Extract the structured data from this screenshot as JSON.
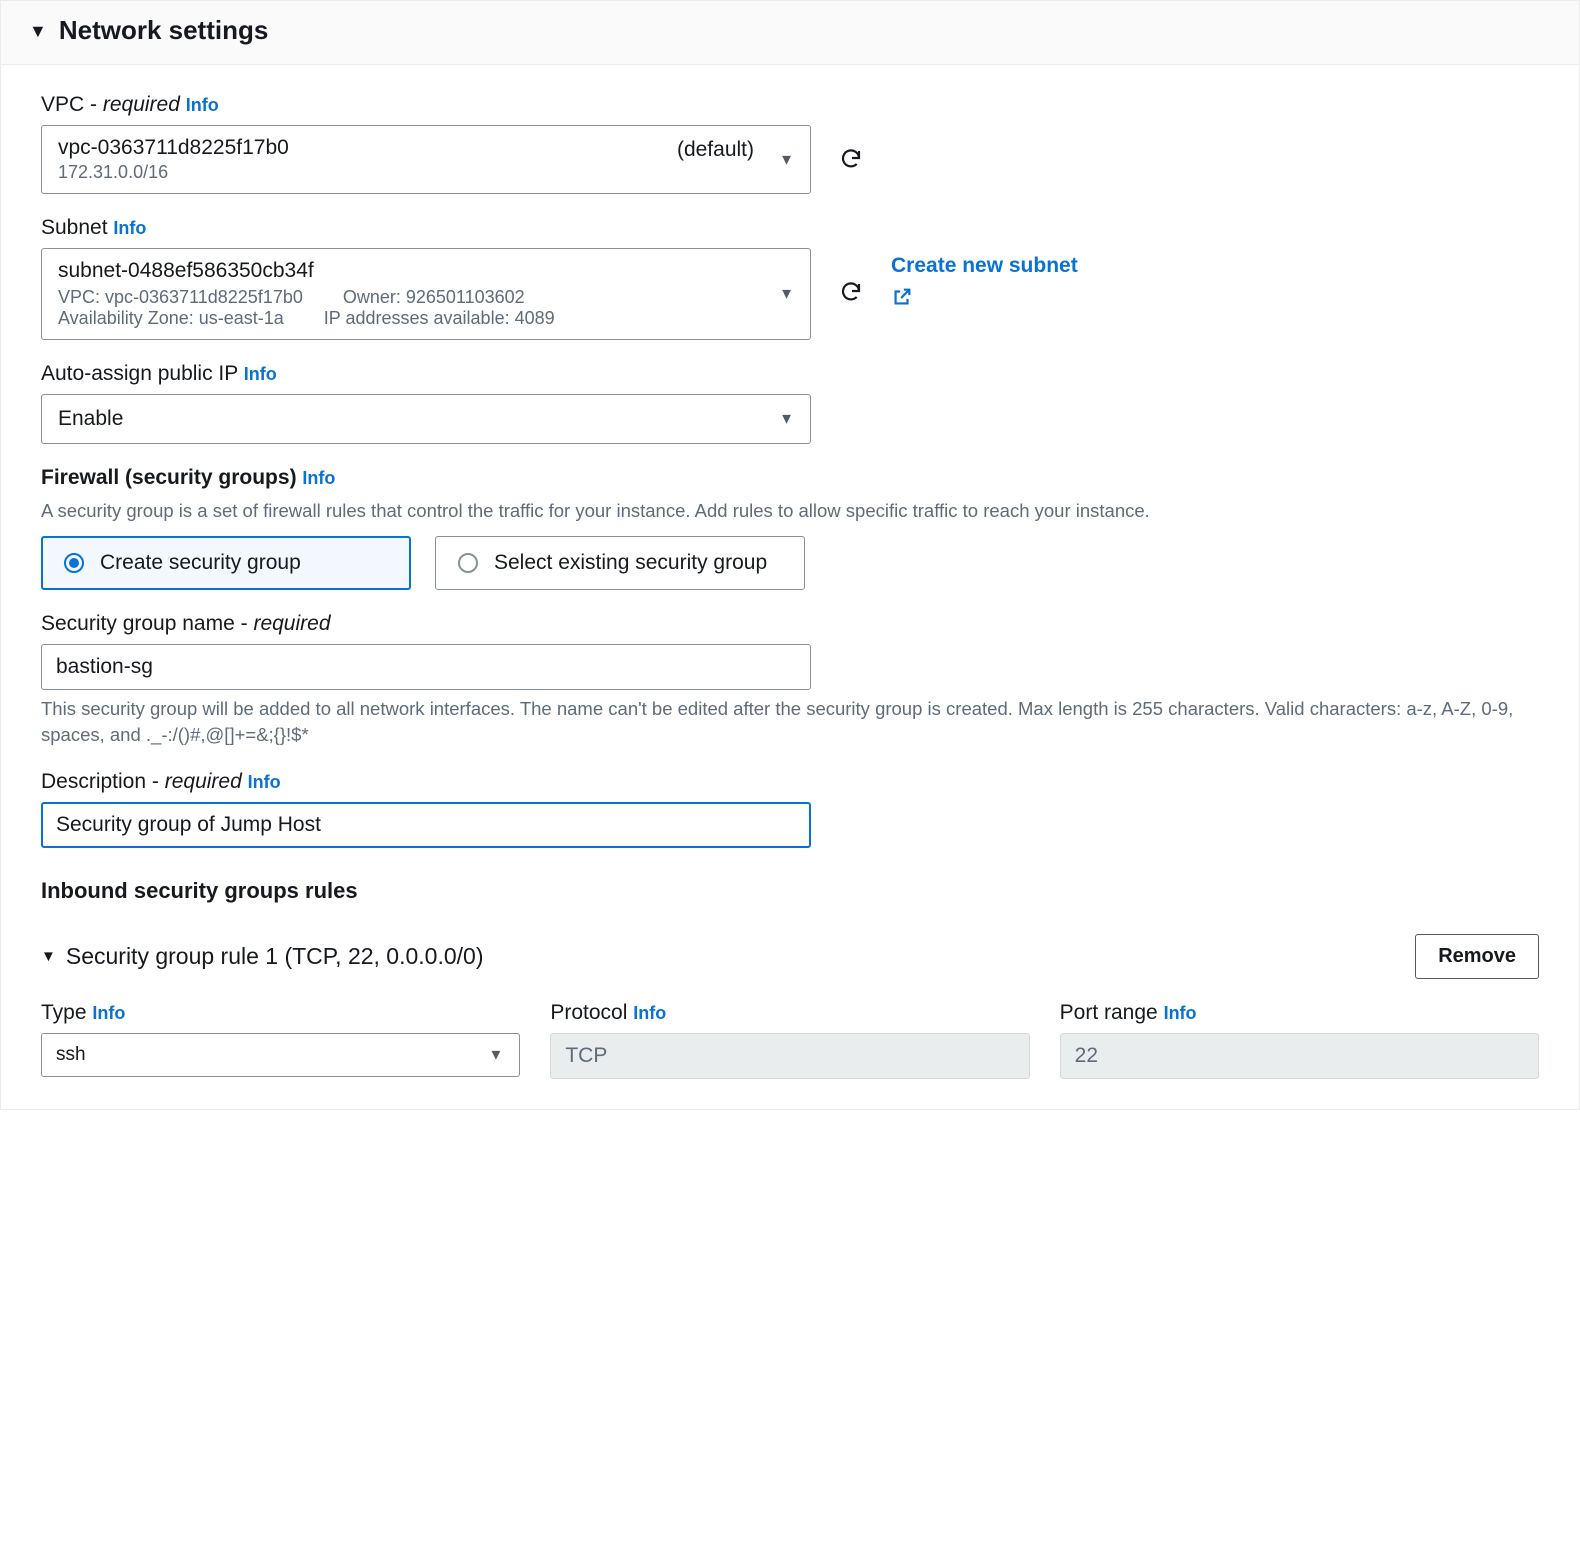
{
  "header": {
    "title": "Network settings"
  },
  "labels": {
    "info": "Info",
    "required": "required"
  },
  "vpc": {
    "label": "VPC",
    "value": "vpc-0363711d8225f17b0",
    "cidr": "172.31.0.0/16",
    "tag": "(default)"
  },
  "subnet": {
    "label": "Subnet",
    "value": "subnet-0488ef586350cb34f",
    "vpc_line": "VPC: vpc-0363711d8225f17b0",
    "owner_line": "Owner: 926501103602",
    "az_line": "Availability Zone: us-east-1a",
    "ips_line": "IP addresses available: 4089",
    "create_link": "Create new subnet"
  },
  "auto_ip": {
    "label": "Auto-assign public IP",
    "value": "Enable"
  },
  "firewall": {
    "label": "Firewall (security groups)",
    "help": "A security group is a set of firewall rules that control the traffic for your instance. Add rules to allow specific traffic to reach your instance.",
    "opt_create": "Create security group",
    "opt_select": "Select existing security group"
  },
  "sg_name": {
    "label": "Security group name",
    "value": "bastion-sg",
    "help": "This security group will be added to all network interfaces. The name can't be edited after the security group is created. Max length is 255 characters. Valid characters: a-z, A-Z, 0-9, spaces, and ._-:/()#,@[]+=&;{}!$*"
  },
  "sg_desc": {
    "label": "Description",
    "value": "Security group of Jump Host"
  },
  "inbound": {
    "heading": "Inbound security groups rules",
    "rule_title": "Security group rule 1 (TCP, 22, 0.0.0.0/0)",
    "remove": "Remove",
    "type_label": "Type",
    "type_value": "ssh",
    "protocol_label": "Protocol",
    "protocol_value": "TCP",
    "port_label": "Port range",
    "port_value": "22"
  }
}
